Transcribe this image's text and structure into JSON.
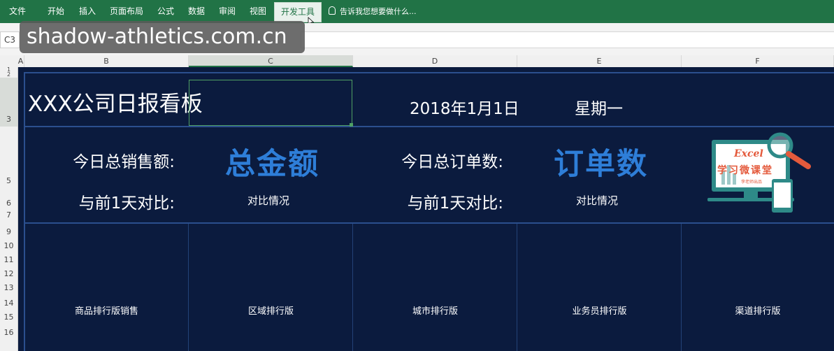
{
  "ribbon": {
    "menu": [
      "文件",
      "开始",
      "插入",
      "页面布局",
      "公式",
      "数据",
      "审阅",
      "视图",
      "开发工具"
    ],
    "active_tab": "开发工具",
    "tell_me": "告诉我您想要做什么..."
  },
  "formula_bar": {
    "name_box": "C3",
    "watermark": "shadow-athletics.com.cn"
  },
  "columns": [
    "A",
    "B",
    "C",
    "D",
    "E",
    "F"
  ],
  "rows": [
    "1",
    "2",
    "3",
    "5",
    "6",
    "7",
    "9",
    "10",
    "11",
    "12",
    "13",
    "14",
    "15",
    "16"
  ],
  "dashboard": {
    "title": "XXX公司日报看板",
    "date": "2018年1月1日",
    "weekday": "星期一",
    "sales_label": "今日总销售额:",
    "sales_value": "总金额",
    "orders_label": "今日总订单数:",
    "orders_value": "订单数",
    "compare_label": "与前1天对比:",
    "compare_text": "对比情况",
    "rankings": [
      "商品排行版销售",
      "区域排行版",
      "城市排行版",
      "业务员排行版",
      "渠道排行版"
    ],
    "logo": {
      "line1": "Excel",
      "line2": "学习微课堂",
      "line3": "李老师出品"
    }
  },
  "colors": {
    "ribbon": "#217346",
    "sheet_bg": "#0b1b3e",
    "accent_blue": "#2e7ed8",
    "border_blue": "#2b4f8e"
  }
}
